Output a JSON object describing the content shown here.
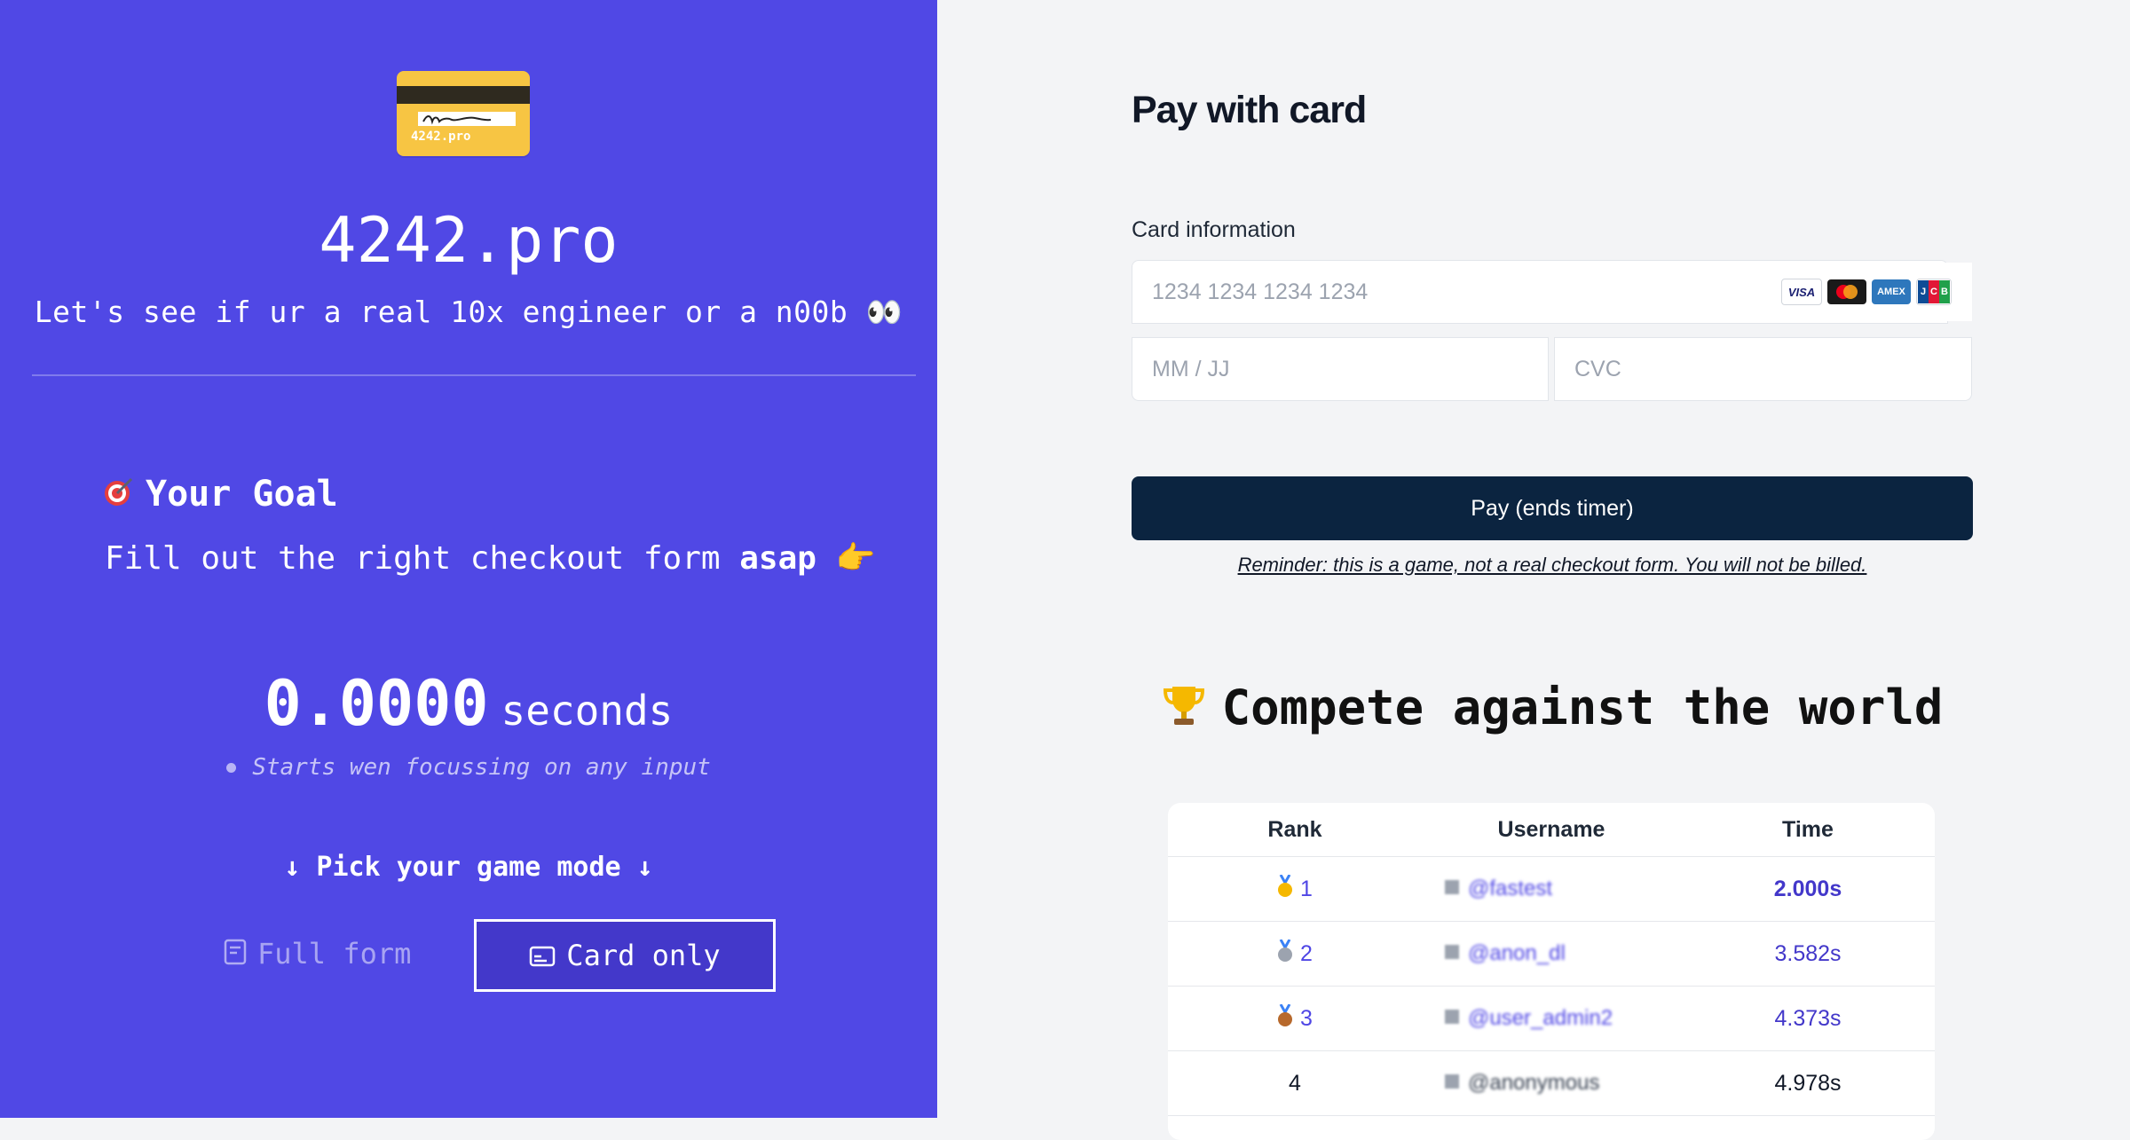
{
  "left": {
    "logo_text": "4242.pro",
    "brand": "4242.pro",
    "tagline": "Let's see if ur a real 10x engineer or a n00b 👀",
    "goal": {
      "title": "Your Goal",
      "text_prefix": "Fill out the right checkout form ",
      "text_bold": "asap",
      "pointer": "👉"
    },
    "timer": {
      "value": "0.0000",
      "unit": "seconds",
      "hint": "Starts wen focussing on any input"
    },
    "pick_label": "↓ Pick your game mode ↓",
    "modes": [
      {
        "label": "Full form",
        "selected": false
      },
      {
        "label": "Card only",
        "selected": true
      }
    ],
    "colors": {
      "panel": "#5048e5",
      "selected_mode": "#4338ca"
    }
  },
  "right": {
    "title": "Pay with card",
    "card_label": "Card information",
    "card_number_placeholder": "1234 1234 1234 1234",
    "expiry_placeholder": "MM / JJ",
    "cvc_placeholder": "CVC",
    "brands": [
      "VISA",
      "mastercard",
      "AMEX",
      "JCB"
    ],
    "pay_button": "Pay (ends timer)",
    "reminder": "Reminder: this is a game, not a real checkout form. You will not be billed.",
    "compete_title": "Compete against the world",
    "leaderboard": {
      "headers": {
        "rank": "Rank",
        "username": "Username",
        "time": "Time"
      },
      "rows": [
        {
          "rank": "1",
          "medal": "gold-medal-icon",
          "username": "@fastest",
          "time": "2.000s"
        },
        {
          "rank": "2",
          "medal": "silver-medal-icon",
          "username": "@anon_dl",
          "time": "3.582s"
        },
        {
          "rank": "3",
          "medal": "bronze-medal-icon",
          "username": "@user_admin2",
          "time": "4.373s"
        },
        {
          "rank": "4",
          "medal": "",
          "username": "@anonymous",
          "time": "4.978s"
        }
      ]
    },
    "colors": {
      "button": "#0b2440",
      "accent": "#4f46e5"
    }
  }
}
